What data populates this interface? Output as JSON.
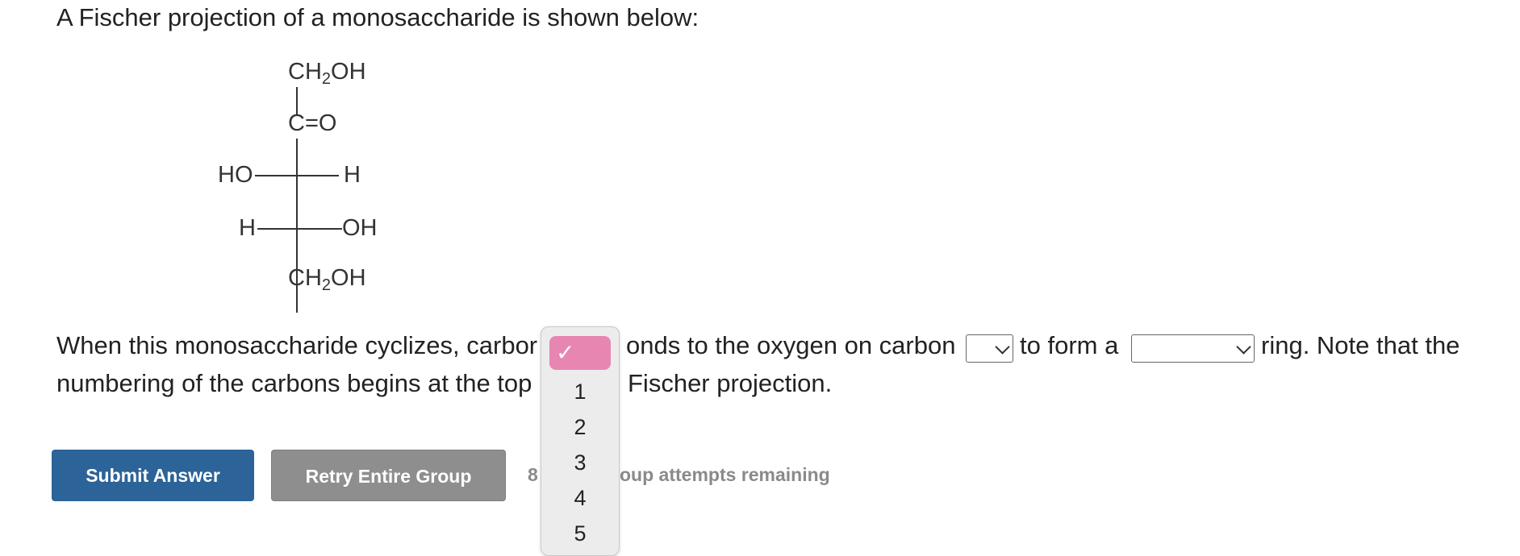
{
  "prompt": "A Fischer projection of a monosaccharide is shown below:",
  "structure": {
    "top_group": "CH",
    "top_sub": "2",
    "top_tail": "OH",
    "carbonyl": "C=O",
    "row1_left": "HO",
    "row1_right": "H",
    "row2_left": "H",
    "row2_right": "OH",
    "bottom_group": "CH",
    "bottom_sub": "2",
    "bottom_tail": "OH"
  },
  "question": {
    "line1_part1": "When this monosaccharide cyclizes, carbor",
    "line1_part2": "onds to the oxygen on carbon",
    "line1_part3": "to form a",
    "line1_part4": "ring. Note that the",
    "line2_part1": "numbering of the carbons begins at the top",
    "line2_part2": "Fischer projection."
  },
  "dropdown": {
    "checkmark": "✓",
    "options": [
      "1",
      "2",
      "3",
      "4",
      "5"
    ]
  },
  "buttons": {
    "submit": "Submit Answer",
    "retry": "Retry Entire Group"
  },
  "attempts": {
    "count": "8",
    "text": "oup attempts remaining"
  },
  "colors": {
    "submit_bg": "#2c6398",
    "retry_bg": "#8e8e8e",
    "highlight": "#e786b0"
  }
}
